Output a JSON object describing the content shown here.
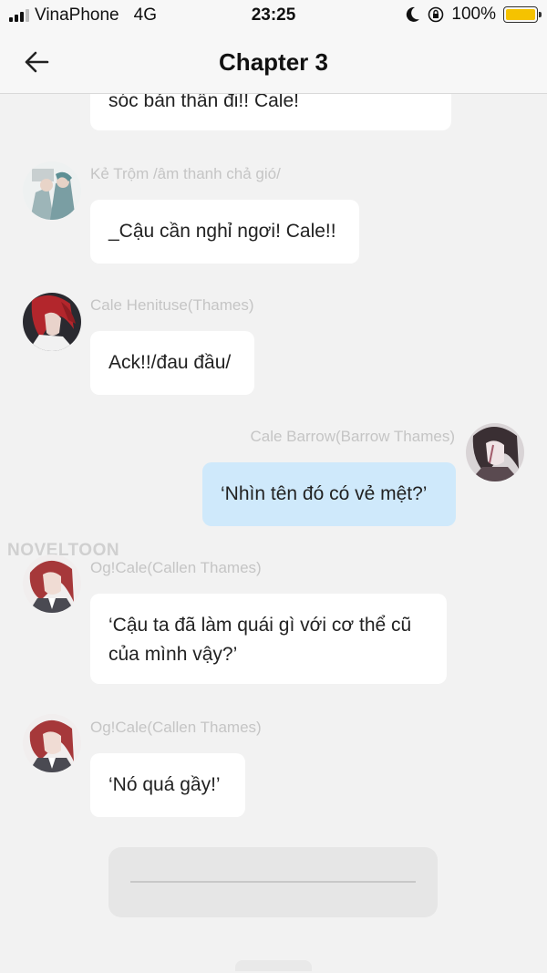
{
  "status_bar": {
    "carrier": "VinaPhone",
    "network": "4G",
    "time": "23:25",
    "battery": "100%",
    "battery_level": 1.0,
    "battery_color": "#f5c200"
  },
  "header": {
    "title": "Chapter 3",
    "back_icon": "arrow-left-icon"
  },
  "messages": [
    {
      "side": "left",
      "name": "",
      "text": "sóc bản thân đi!! Cale!"
    },
    {
      "side": "left",
      "name": "Kẻ Trộm /âm thanh chả gió/",
      "text": "_Cậu cần nghỉ ngơi! Cale!!"
    },
    {
      "side": "left",
      "name": "Cale Henituse(Thames)",
      "text": "Ack!!/đau đầu/"
    },
    {
      "side": "right",
      "name": "Cale Barrow(Barrow Thames)",
      "text": "‘Nhìn tên đó có vẻ mệt?’"
    },
    {
      "side": "left",
      "name": "Og!Cale(Callen Thames)",
      "text": "‘Cậu ta đã làm quái gì với cơ thể cũ của mình vậy?’"
    },
    {
      "side": "left",
      "name": "Og!Cale(Callen Thames)",
      "text": "‘Nó quá gầy!’"
    }
  ],
  "watermark": "NOVELTOON",
  "colors": {
    "background": "#f2f2f2",
    "bubble_left": "#ffffff",
    "bubble_right": "#cfe9fb",
    "name_text": "#c5c5c5"
  }
}
